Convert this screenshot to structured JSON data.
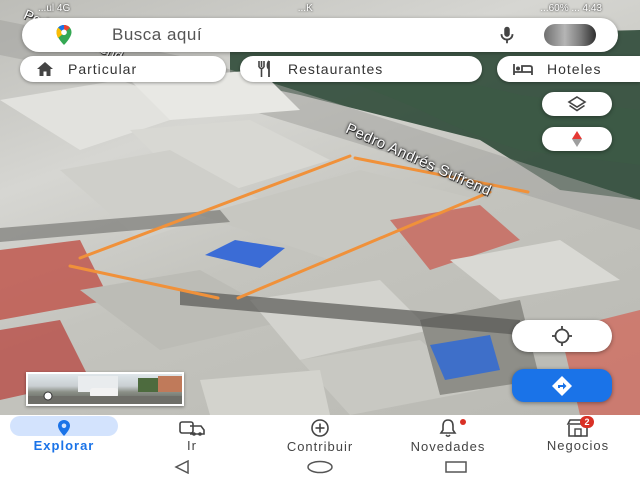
{
  "status_bar": {
    "left": "...ul 4G",
    "center": "...K",
    "right": "...60% ... 4:43"
  },
  "search": {
    "placeholder": "Busca aquí"
  },
  "chips": [
    {
      "label": "Particular",
      "icon": "home-icon"
    },
    {
      "label": "Restaurantes",
      "icon": "restaurant-icon"
    },
    {
      "label": "Hoteles",
      "icon": "hotel-icon"
    }
  ],
  "map": {
    "street_name": "Pedro Andrés Sufrend",
    "street_name_top": "Pedro A. Sufrend",
    "boundary_color": "#f0913a"
  },
  "controls": {
    "layers_icon": "layers-icon",
    "compass_icon": "compass-icon",
    "location_icon": "my-location-icon",
    "directions_icon": "directions-icon"
  },
  "bottom_nav": {
    "items": [
      {
        "label": "Explorar",
        "icon": "explore-pin-icon",
        "active": true
      },
      {
        "label": "Ir",
        "icon": "commute-icon"
      },
      {
        "label": "Contribuir",
        "icon": "add-circle-icon"
      },
      {
        "label": "Novedades",
        "icon": "bell-icon"
      },
      {
        "label": "Negocios",
        "icon": "store-icon",
        "badge": "2"
      }
    ]
  },
  "colors": {
    "accent": "#1a73e8",
    "active_pill": "#d3e3fd",
    "badge": "#d93025"
  }
}
